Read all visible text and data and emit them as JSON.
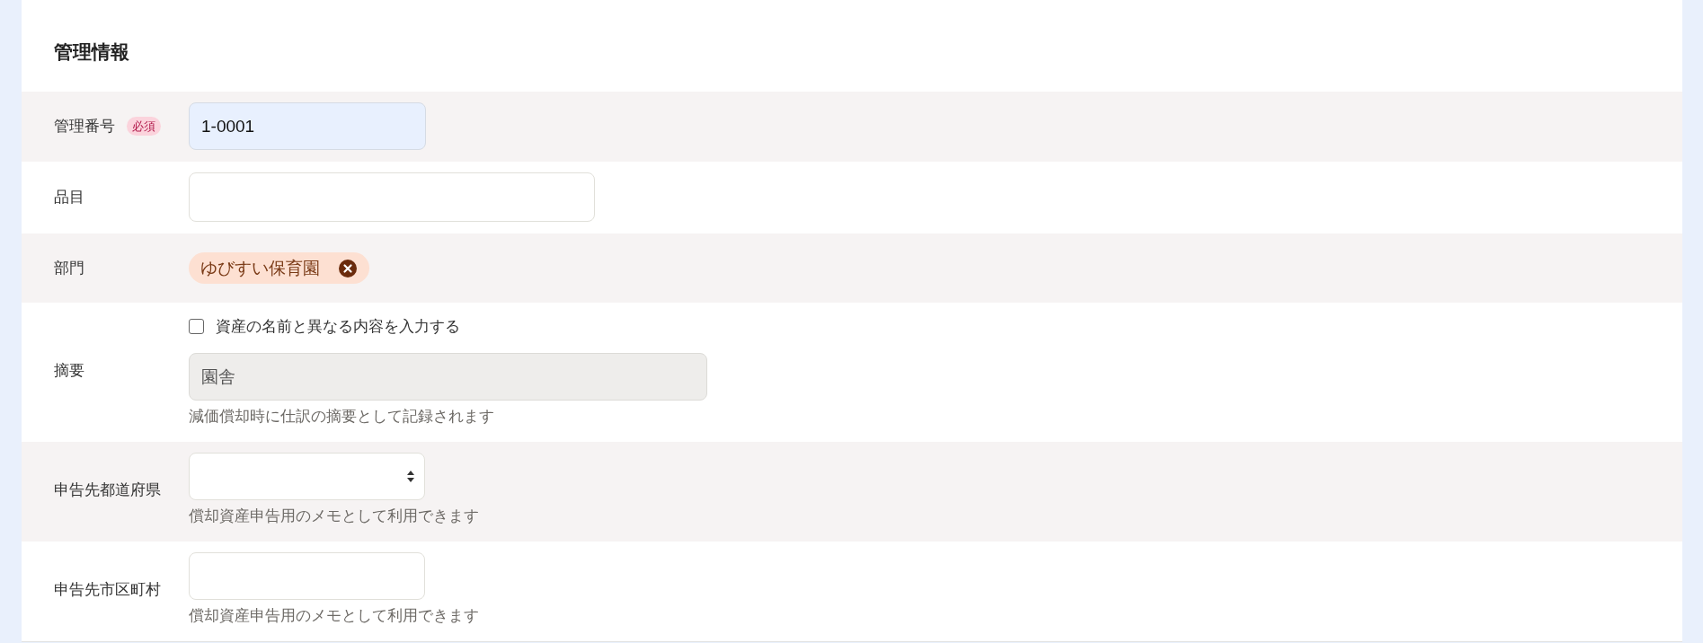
{
  "section": {
    "title": "管理情報"
  },
  "fields": [
    {
      "kind": "text",
      "label": "管理番号",
      "badge": "必須",
      "value": "1-0001",
      "autofilled": true,
      "disabled": false
    },
    {
      "kind": "text",
      "label": "品目",
      "autofilled": false,
      "disabled": false
    },
    {
      "kind": "tags",
      "label": "部門",
      "tags": [
        {
          "label": "ゆびすい保育園"
        }
      ]
    },
    {
      "kind": "text",
      "label": "摘要",
      "checkbox": {
        "label": "資産の名前と異なる内容を入力する",
        "checked": false
      },
      "value": "園舎",
      "autofilled": false,
      "disabled": true,
      "hint": "減価償却時に仕訳の摘要として記録されます"
    },
    {
      "kind": "select",
      "label": "申告先都道府県",
      "hint": "償却資産申告用のメモとして利用できます"
    },
    {
      "kind": "text",
      "label": "申告先市区町村",
      "autofilled": false,
      "disabled": false,
      "hint": "償却資産申告用のメモとして利用できます"
    }
  ]
}
